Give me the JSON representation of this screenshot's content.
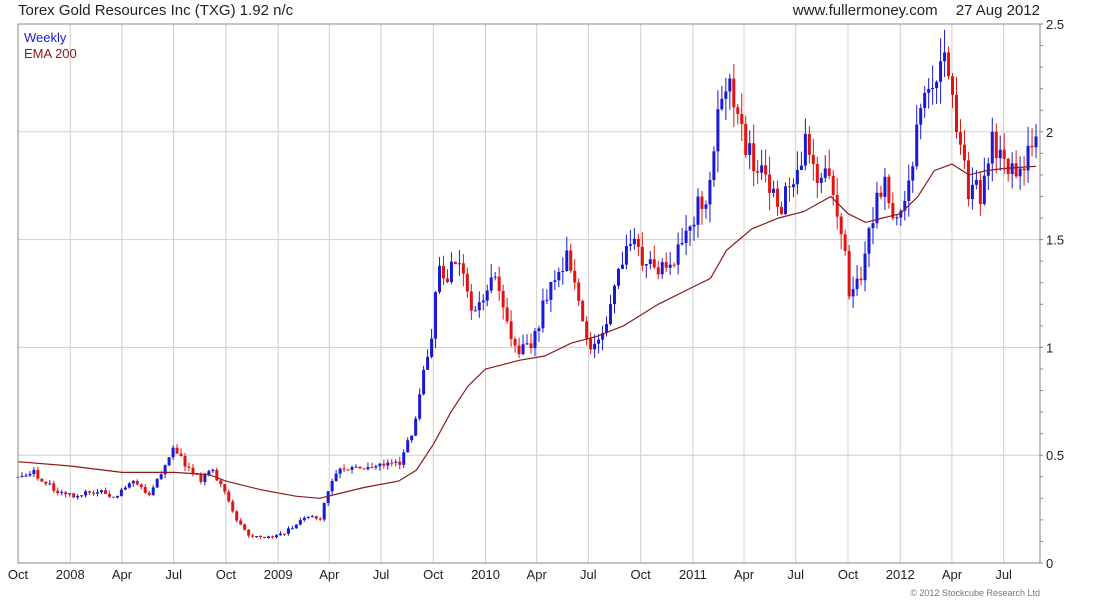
{
  "header": {
    "title": "Torex Gold Resources Inc (TXG) 1.92 n/c",
    "site": "www.fullermoney.com",
    "date": "27 Aug 2012"
  },
  "copyright": "© 2012 Stockcube Research Ltd",
  "colors": {
    "up": "#1a1ad6",
    "down": "#e01414",
    "ema": "#8b1a1a",
    "grid": "#cfcfcf",
    "frame": "#888888",
    "weekly_label": "#1a1ad6",
    "ema_label": "#8b1a1a"
  },
  "chart_data": {
    "type": "candlestick",
    "interval": "weekly",
    "legend": [
      "Weekly",
      "EMA 200"
    ],
    "legend_position": "top-left",
    "grid": true,
    "y_axis_side": "right",
    "ylim": [
      0,
      2.5
    ],
    "yticks": [
      0,
      0.5,
      1,
      1.5,
      2,
      2.5
    ],
    "xlim": [
      "2007-10-01",
      "2012-09-03"
    ],
    "xticks": [
      {
        "label": "Oct",
        "date": "2007-10-01"
      },
      {
        "label": "2008",
        "date": "2008-01-01"
      },
      {
        "label": "Apr",
        "date": "2008-04-01"
      },
      {
        "label": "Jul",
        "date": "2008-07-01"
      },
      {
        "label": "Oct",
        "date": "2008-10-01"
      },
      {
        "label": "2009",
        "date": "2009-01-01"
      },
      {
        "label": "Apr",
        "date": "2009-04-01"
      },
      {
        "label": "Jul",
        "date": "2009-07-01"
      },
      {
        "label": "Oct",
        "date": "2009-10-01"
      },
      {
        "label": "2010",
        "date": "2010-01-01"
      },
      {
        "label": "Apr",
        "date": "2010-04-01"
      },
      {
        "label": "Jul",
        "date": "2010-07-01"
      },
      {
        "label": "Oct",
        "date": "2010-10-01"
      },
      {
        "label": "2011",
        "date": "2011-01-01"
      },
      {
        "label": "Apr",
        "date": "2011-04-01"
      },
      {
        "label": "Jul",
        "date": "2011-07-01"
      },
      {
        "label": "Oct",
        "date": "2011-10-01"
      },
      {
        "label": "2012",
        "date": "2012-01-01"
      },
      {
        "label": "Apr",
        "date": "2012-04-01"
      },
      {
        "label": "Jul",
        "date": "2012-07-01"
      }
    ],
    "close_path": [
      [
        "2007-10-01",
        0.4
      ],
      [
        "2007-10-29",
        0.42
      ],
      [
        "2007-12-10",
        0.33
      ],
      [
        "2008-01-14",
        0.31
      ],
      [
        "2008-02-18",
        0.34
      ],
      [
        "2008-03-17",
        0.31
      ],
      [
        "2008-04-21",
        0.37
      ],
      [
        "2008-05-19",
        0.32
      ],
      [
        "2008-06-16",
        0.46
      ],
      [
        "2008-07-01",
        0.53
      ],
      [
        "2008-07-21",
        0.46
      ],
      [
        "2008-08-18",
        0.38
      ],
      [
        "2008-09-08",
        0.43
      ],
      [
        "2008-09-29",
        0.32
      ],
      [
        "2008-10-20",
        0.2
      ],
      [
        "2008-11-10",
        0.13
      ],
      [
        "2008-12-08",
        0.11
      ],
      [
        "2009-01-05",
        0.13
      ],
      [
        "2009-02-02",
        0.18
      ],
      [
        "2009-02-23",
        0.22
      ],
      [
        "2009-03-16",
        0.21
      ],
      [
        "2009-03-30",
        0.34
      ],
      [
        "2009-04-20",
        0.43
      ],
      [
        "2009-05-18",
        0.45
      ],
      [
        "2009-06-15",
        0.44
      ],
      [
        "2009-07-13",
        0.47
      ],
      [
        "2009-08-03",
        0.46
      ],
      [
        "2009-08-24",
        0.6
      ],
      [
        "2009-09-07",
        0.78
      ],
      [
        "2009-09-28",
        1.05
      ],
      [
        "2009-10-12",
        1.38
      ],
      [
        "2009-10-26",
        1.33
      ],
      [
        "2009-11-16",
        1.4
      ],
      [
        "2009-12-07",
        1.19
      ],
      [
        "2009-12-28",
        1.21
      ],
      [
        "2010-01-18",
        1.37
      ],
      [
        "2010-02-08",
        1.12
      ],
      [
        "2010-03-01",
        0.96
      ],
      [
        "2010-03-22",
        1.02
      ],
      [
        "2010-04-12",
        1.18
      ],
      [
        "2010-05-03",
        1.3
      ],
      [
        "2010-05-24",
        1.4
      ],
      [
        "2010-06-14",
        1.19
      ],
      [
        "2010-07-05",
        0.97
      ],
      [
        "2010-07-26",
        1.05
      ],
      [
        "2010-08-16",
        1.3
      ],
      [
        "2010-09-06",
        1.48
      ],
      [
        "2010-09-27",
        1.45
      ],
      [
        "2010-10-25",
        1.35
      ],
      [
        "2010-11-22",
        1.4
      ],
      [
        "2010-12-13",
        1.5
      ],
      [
        "2011-01-03",
        1.62
      ],
      [
        "2011-01-24",
        1.7
      ],
      [
        "2011-02-14",
        2.1
      ],
      [
        "2011-03-07",
        2.2
      ],
      [
        "2011-03-28",
        2.0
      ],
      [
        "2011-04-25",
        1.82
      ],
      [
        "2011-05-16",
        1.75
      ],
      [
        "2011-06-06",
        1.65
      ],
      [
        "2011-06-27",
        1.8
      ],
      [
        "2011-07-18",
        1.95
      ],
      [
        "2011-08-08",
        1.72
      ],
      [
        "2011-08-29",
        1.85
      ],
      [
        "2011-09-19",
        1.55
      ],
      [
        "2011-10-03",
        1.28
      ],
      [
        "2011-10-24",
        1.35
      ],
      [
        "2011-11-14",
        1.62
      ],
      [
        "2011-12-05",
        1.75
      ],
      [
        "2011-12-26",
        1.55
      ],
      [
        "2012-01-16",
        1.8
      ],
      [
        "2012-02-06",
        2.1
      ],
      [
        "2012-02-27",
        2.2
      ],
      [
        "2012-03-19",
        2.3
      ],
      [
        "2012-04-09",
        2.0
      ],
      [
        "2012-04-30",
        1.75
      ],
      [
        "2012-05-21",
        1.7
      ],
      [
        "2012-06-11",
        1.95
      ],
      [
        "2012-07-02",
        1.85
      ],
      [
        "2012-07-23",
        1.8
      ],
      [
        "2012-08-13",
        1.88
      ],
      [
        "2012-08-27",
        1.92
      ]
    ],
    "ema_path": [
      [
        "2007-10-01",
        0.47
      ],
      [
        "2008-01-01",
        0.45
      ],
      [
        "2008-04-01",
        0.42
      ],
      [
        "2008-07-01",
        0.42
      ],
      [
        "2008-09-01",
        0.41
      ],
      [
        "2008-10-01",
        0.38
      ],
      [
        "2008-12-01",
        0.34
      ],
      [
        "2009-02-01",
        0.31
      ],
      [
        "2009-03-15",
        0.3
      ],
      [
        "2009-04-15",
        0.32
      ],
      [
        "2009-06-01",
        0.35
      ],
      [
        "2009-08-01",
        0.38
      ],
      [
        "2009-09-01",
        0.43
      ],
      [
        "2009-10-01",
        0.55
      ],
      [
        "2009-11-01",
        0.7
      ],
      [
        "2009-12-01",
        0.82
      ],
      [
        "2010-01-01",
        0.9
      ],
      [
        "2010-02-01",
        0.92
      ],
      [
        "2010-03-01",
        0.94
      ],
      [
        "2010-04-15",
        0.96
      ],
      [
        "2010-06-01",
        1.02
      ],
      [
        "2010-07-15",
        1.05
      ],
      [
        "2010-09-01",
        1.1
      ],
      [
        "2010-11-01",
        1.2
      ],
      [
        "2011-01-01",
        1.28
      ],
      [
        "2011-02-01",
        1.32
      ],
      [
        "2011-03-01",
        1.45
      ],
      [
        "2011-04-15",
        1.55
      ],
      [
        "2011-06-01",
        1.6
      ],
      [
        "2011-07-15",
        1.63
      ],
      [
        "2011-09-01",
        1.7
      ],
      [
        "2011-10-01",
        1.62
      ],
      [
        "2011-11-01",
        1.58
      ],
      [
        "2011-12-01",
        1.6
      ],
      [
        "2012-01-01",
        1.62
      ],
      [
        "2012-02-01",
        1.7
      ],
      [
        "2012-03-01",
        1.82
      ],
      [
        "2012-04-01",
        1.85
      ],
      [
        "2012-05-01",
        1.8
      ],
      [
        "2012-06-01",
        1.82
      ],
      [
        "2012-07-01",
        1.83
      ],
      [
        "2012-08-27",
        1.84
      ]
    ]
  }
}
